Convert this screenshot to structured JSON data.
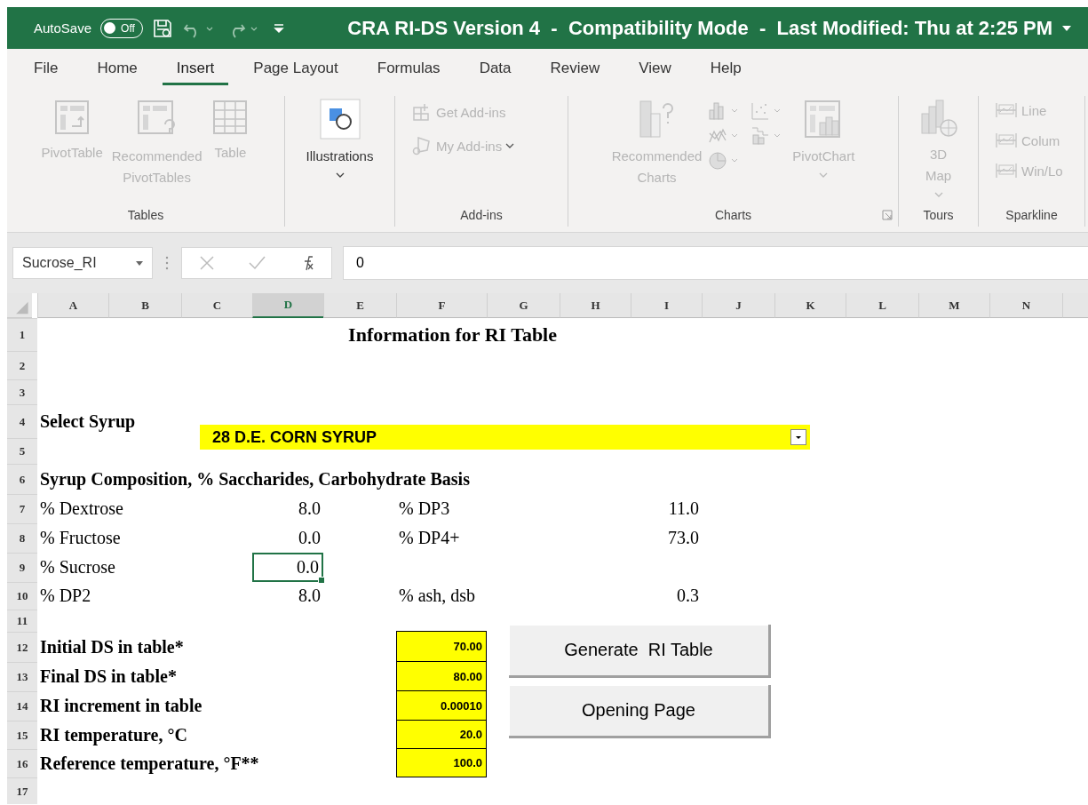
{
  "title_bar": {
    "autosave_label": "AutoSave",
    "autosave": {
      "on": false,
      "label": "Off"
    },
    "title": "CRA RI-DS Version 4  -  Compatibility Mode  -  Last Modified: Thu at 2:25 PM"
  },
  "tabs": [
    {
      "label": "File",
      "selected": false
    },
    {
      "label": "Home",
      "selected": false
    },
    {
      "label": "Insert",
      "selected": true
    },
    {
      "label": "Page Layout",
      "selected": false
    },
    {
      "label": "Formulas",
      "selected": false
    },
    {
      "label": "Data",
      "selected": false
    },
    {
      "label": "Review",
      "selected": false
    },
    {
      "label": "View",
      "selected": false
    },
    {
      "label": "Help",
      "selected": false
    }
  ],
  "ribbon": {
    "groups": [
      {
        "kind": "large",
        "label": "Tables",
        "items": [
          {
            "label": "PivotTable",
            "disabled": true
          },
          {
            "label": "Recommended PivotTables",
            "disabled": true
          },
          {
            "label": "Table",
            "disabled": true
          }
        ]
      },
      {
        "kind": "large",
        "items": [
          {
            "label": "Illustrations",
            "disabled": false
          }
        ]
      },
      {
        "kind": "small",
        "label": "Add-ins",
        "items": [
          {
            "label": "Get Add-ins",
            "disabled": true
          },
          {
            "label": "My Add-ins",
            "disabled": true
          }
        ]
      },
      {
        "kind": "charts",
        "label": "Charts",
        "items": [
          {
            "label": "Recommended Charts",
            "disabled": true
          },
          {
            "label": "PivotChart",
            "disabled": true
          }
        ]
      },
      {
        "kind": "large",
        "label": "Tours",
        "items": [
          {
            "label": "3D Map",
            "disabled": true
          }
        ]
      },
      {
        "kind": "small",
        "label": "Sparkline",
        "items": [
          {
            "label": "Line",
            "disabled": true
          },
          {
            "label": "Colum",
            "disabled": true
          },
          {
            "label": "Win/Lo",
            "disabled": true
          }
        ]
      }
    ]
  },
  "formula_bar": {
    "name_box": "Sucrose_RI",
    "formula": "0"
  },
  "sheet": {
    "columns": [
      {
        "label": "A",
        "selected": false
      },
      {
        "label": "B",
        "selected": false
      },
      {
        "label": "C",
        "selected": false
      },
      {
        "label": "D",
        "selected": true
      },
      {
        "label": "E",
        "selected": false
      },
      {
        "label": "F",
        "selected": false
      },
      {
        "label": "G",
        "selected": false
      },
      {
        "label": "H",
        "selected": false
      },
      {
        "label": "I",
        "selected": false
      },
      {
        "label": "J",
        "selected": false
      },
      {
        "label": "K",
        "selected": false
      },
      {
        "label": "L",
        "selected": false
      },
      {
        "label": "M",
        "selected": false
      },
      {
        "label": "N",
        "selected": false
      }
    ],
    "rows": [
      {
        "number": "1",
        "kind": "title",
        "text": "Information for RI Table"
      },
      {
        "number": "2",
        "kind": "empty"
      },
      {
        "number": "3",
        "kind": "empty"
      },
      {
        "number": "4",
        "kind": "label",
        "text": "Select Syrup"
      },
      {
        "number": "5",
        "kind": "empty"
      },
      {
        "number": "6",
        "kind": "label",
        "text": "Syrup Composition, % Saccharides, Carbohydrate Basis"
      },
      {
        "number": "7",
        "kind": "pair",
        "label": "% Dextrose",
        "value": "8.0",
        "selected": false,
        "label_2": "% DP3",
        "value_2": "11.0"
      },
      {
        "number": "8",
        "kind": "pair",
        "label": "% Fructose",
        "value": "0.0",
        "selected": false,
        "label_2": "% DP4+",
        "value_2": "73.0"
      },
      {
        "number": "9",
        "kind": "pair",
        "label": "% Sucrose",
        "value": "0.0",
        "selected": true
      },
      {
        "number": "10",
        "kind": "pair",
        "label": "% DP2",
        "value": "8.0",
        "selected": false,
        "label_2": "% ash, dsb",
        "value_2": "0.3"
      },
      {
        "number": "11",
        "kind": "empty"
      },
      {
        "number": "12",
        "kind": "input",
        "label": "Initial DS in table*",
        "value": "70.00"
      },
      {
        "number": "13",
        "kind": "input",
        "label": "Final DS in table*",
        "value": "80.00"
      },
      {
        "number": "14",
        "kind": "input",
        "label": "RI increment in table",
        "value": "0.00010"
      },
      {
        "number": "15",
        "kind": "input",
        "label": "RI temperature, °C",
        "value": "20.0"
      },
      {
        "number": "16",
        "kind": "input",
        "label": "Reference temperature, °F**",
        "value": "100.0"
      },
      {
        "number": "17",
        "kind": "empty"
      }
    ],
    "dropdown": {
      "value": "28 D.E. CORN SYRUP"
    },
    "buttons": [
      "Generate  RI Table",
      "Opening Page"
    ]
  }
}
